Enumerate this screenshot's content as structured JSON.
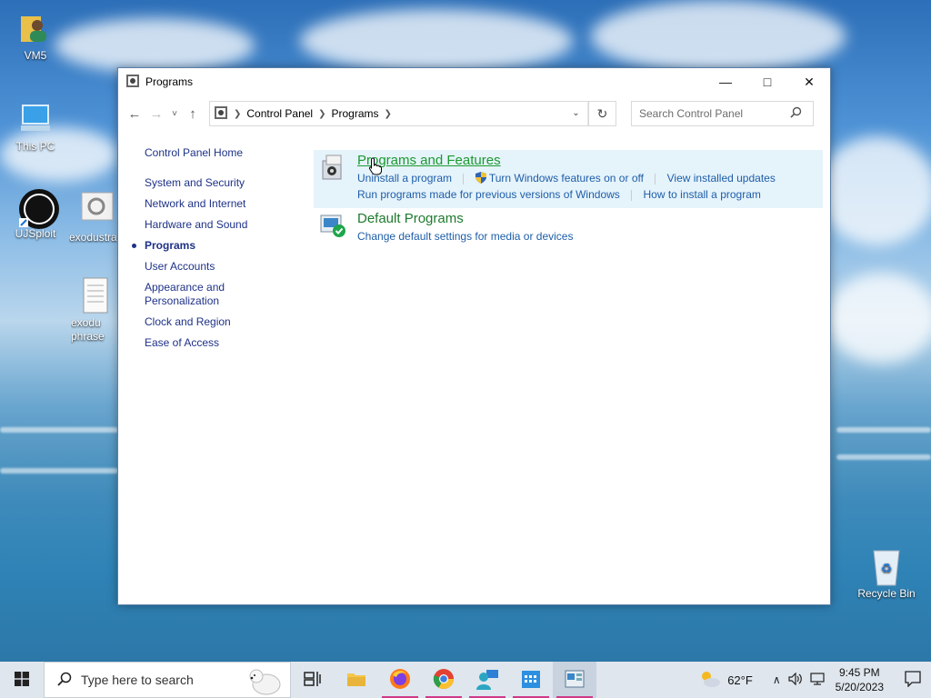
{
  "window": {
    "title": "Programs",
    "minimize": "—",
    "maximize": "□",
    "close": "✕"
  },
  "navbar": {
    "back": "←",
    "forward": "→",
    "recent": "˅",
    "up": "↑",
    "breadcrumb": [
      "Control Panel",
      "Programs"
    ],
    "search_placeholder": "Search Control Panel"
  },
  "left_nav": {
    "home": "Control Panel Home",
    "items": [
      {
        "label": "System and Security"
      },
      {
        "label": "Network and Internet"
      },
      {
        "label": "Hardware and Sound"
      },
      {
        "label": "Programs"
      },
      {
        "label": "User Accounts"
      },
      {
        "label": "Appearance and Personalization"
      },
      {
        "label": "Clock and Region"
      },
      {
        "label": "Ease of Access"
      }
    ]
  },
  "categories": [
    {
      "title": "Programs and Features",
      "links_row1": [
        "Uninstall a program",
        "Turn Windows features on or off",
        "View installed updates"
      ],
      "links_row2": [
        "Run programs made for previous versions of Windows",
        "How to install a program"
      ]
    },
    {
      "title": "Default Programs",
      "links_row1": [
        "Change default settings for media or devices"
      ]
    }
  ],
  "desktop_icons": [
    "VM5",
    "This PC",
    "UJSploit",
    "exodustra",
    "exodu phrase pa",
    "Recycle Bin"
  ],
  "taskbar": {
    "search_placeholder": "Type here to search",
    "weather": "62°F",
    "time": "9:45 PM",
    "date": "5/20/2023"
  },
  "colors": {
    "link": "#1e5ea8",
    "category_title": "#1e7a2e",
    "nav_link": "#1e3287",
    "highlight": "#e5f3fb"
  }
}
